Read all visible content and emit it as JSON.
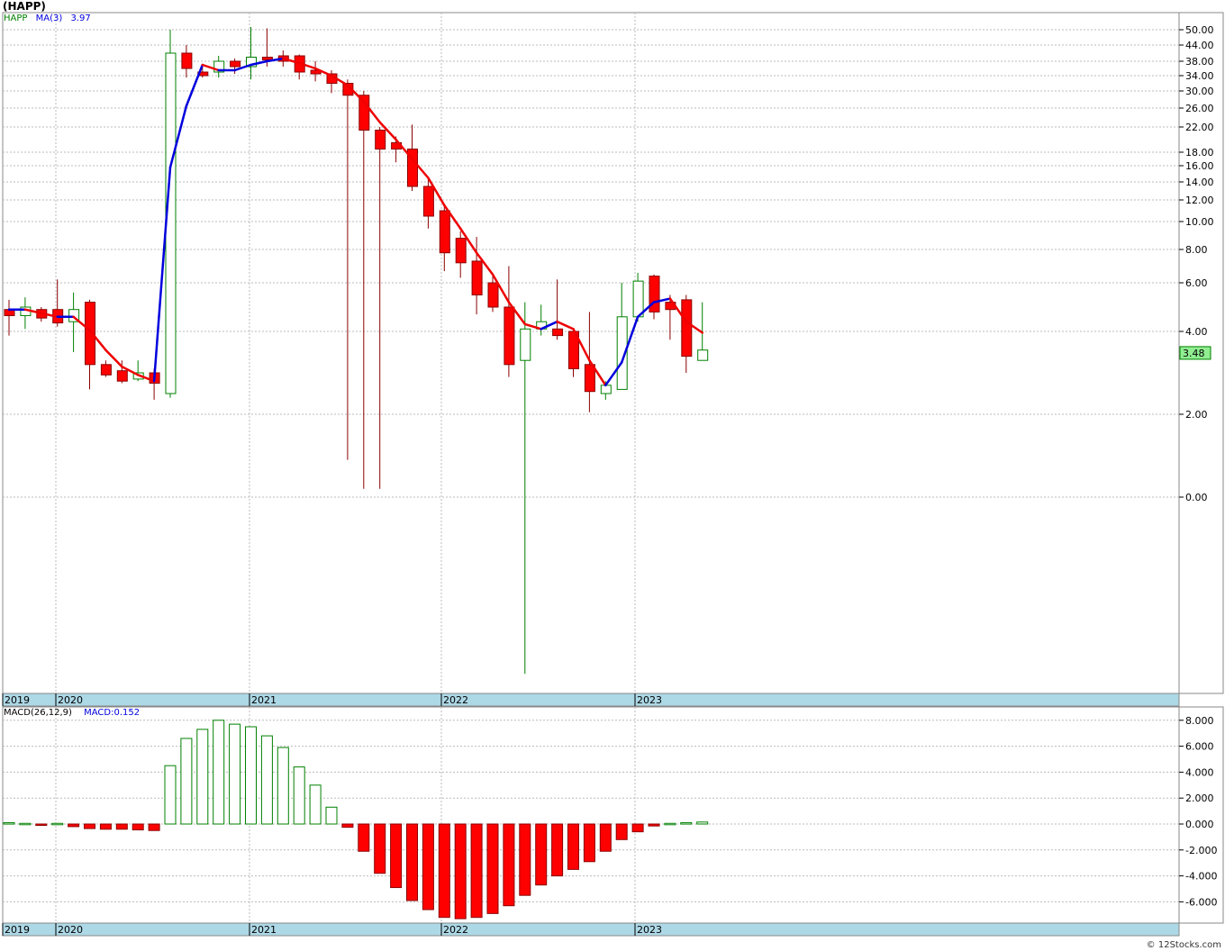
{
  "header": {
    "title": "(HAPP)",
    "symbol": "HAPP",
    "ma_label": "MA(3)",
    "ma_value": "3.97",
    "last_price": "3.48"
  },
  "macd_legend": {
    "label": "MACD(26,12,9)",
    "value": "MACD:0.152"
  },
  "credit": "© 12Stocks.com",
  "colors": {
    "up": "#008000",
    "down": "#ff0000",
    "ma_up": "#0000dd",
    "ma_down": "#ee0000",
    "axis_band": "#add8e6",
    "grid": "#bbbbbb"
  },
  "chart_data": [
    {
      "type": "candlestick",
      "title": "(HAPP)",
      "interval": "monthly",
      "price_axis_ticks": [
        "50.00",
        "44.00",
        "38.00",
        "34.00",
        "30.00",
        "26.00",
        "22.00",
        "18.00",
        "16.00",
        "14.00",
        "12.00",
        "10.00",
        "8.00",
        "6.00",
        "4.00",
        "2.00",
        "0.00"
      ],
      "time_axis_labels": [
        "2019",
        "2020",
        "2021",
        "2022",
        "2023"
      ],
      "ma_period": 3,
      "candles": [
        {
          "o": 4.9,
          "h": 5.3,
          "l": 3.9,
          "c": 4.65
        },
        {
          "o": 4.65,
          "h": 5.4,
          "l": 4.1,
          "c": 5.0
        },
        {
          "o": 4.9,
          "h": 5.0,
          "l": 4.4,
          "c": 4.55
        },
        {
          "o": 4.9,
          "h": 6.2,
          "l": 4.2,
          "c": 4.35
        },
        {
          "o": 4.4,
          "h": 5.6,
          "l": 3.5,
          "c": 4.9
        },
        {
          "o": 5.2,
          "h": 5.3,
          "l": 2.6,
          "c": 3.2
        },
        {
          "o": 3.2,
          "h": 3.3,
          "l": 2.9,
          "c": 2.95
        },
        {
          "o": 3.05,
          "h": 3.3,
          "l": 2.75,
          "c": 2.8
        },
        {
          "o": 2.85,
          "h": 3.3,
          "l": 2.8,
          "c": 3.0
        },
        {
          "o": 3.0,
          "h": 3.1,
          "l": 2.35,
          "c": 2.75
        },
        {
          "o": 2.5,
          "h": 50.0,
          "l": 2.4,
          "c": 41.0
        },
        {
          "o": 41.0,
          "h": 44.0,
          "l": 33.5,
          "c": 36.0
        },
        {
          "o": 35.0,
          "h": 36.5,
          "l": 33.5,
          "c": 34.0
        },
        {
          "o": 35.0,
          "h": 40.0,
          "l": 33.5,
          "c": 38.0
        },
        {
          "o": 38.0,
          "h": 39.0,
          "l": 34.5,
          "c": 36.5
        },
        {
          "o": 36.5,
          "h": 51.0,
          "l": 33.0,
          "c": 39.5
        },
        {
          "o": 39.5,
          "h": 50.5,
          "l": 36.5,
          "c": 38.5
        },
        {
          "o": 40.0,
          "h": 42.0,
          "l": 36.5,
          "c": 38.0
        },
        {
          "o": 40.0,
          "h": 40.5,
          "l": 33.0,
          "c": 35.0
        },
        {
          "o": 35.5,
          "h": 38.0,
          "l": 32.5,
          "c": 34.5
        },
        {
          "o": 34.5,
          "h": 35.5,
          "l": 29.5,
          "c": 32.0
        },
        {
          "o": 32.0,
          "h": 33.0,
          "l": 0.9,
          "c": 29.0
        },
        {
          "o": 29.0,
          "h": 30.0,
          "l": 0.2,
          "c": 21.5
        },
        {
          "o": 21.5,
          "h": 22.0,
          "l": 0.2,
          "c": 18.5
        },
        {
          "o": 19.5,
          "h": 20.5,
          "l": 16.5,
          "c": 18.5
        },
        {
          "o": 18.5,
          "h": 22.5,
          "l": 13.0,
          "c": 13.5
        },
        {
          "o": 13.5,
          "h": 14.5,
          "l": 9.5,
          "c": 10.5
        },
        {
          "o": 11.0,
          "h": 11.5,
          "l": 6.7,
          "c": 7.8
        },
        {
          "o": 8.8,
          "h": 9.3,
          "l": 6.3,
          "c": 7.2
        },
        {
          "o": 7.3,
          "h": 8.9,
          "l": 4.7,
          "c": 5.5
        },
        {
          "o": 6.0,
          "h": 6.6,
          "l": 4.8,
          "c": 5.0
        },
        {
          "o": 5.0,
          "h": 7.0,
          "l": 2.9,
          "c": 3.2
        },
        {
          "o": 3.3,
          "h": 5.2,
          "l": -0.9,
          "c": 4.1
        },
        {
          "o": 4.1,
          "h": 5.1,
          "l": 3.9,
          "c": 4.4
        },
        {
          "o": 4.1,
          "h": 6.2,
          "l": 3.8,
          "c": 3.9
        },
        {
          "o": 4.0,
          "h": 4.1,
          "l": 2.9,
          "c": 3.1
        },
        {
          "o": 3.2,
          "h": 4.8,
          "l": 2.05,
          "c": 2.55
        },
        {
          "o": 2.5,
          "h": 2.8,
          "l": 2.35,
          "c": 2.7
        },
        {
          "o": 2.6,
          "h": 6.0,
          "l": 2.6,
          "c": 4.6
        },
        {
          "o": 4.6,
          "h": 6.6,
          "l": 4.4,
          "c": 6.1
        },
        {
          "o": 6.4,
          "h": 6.5,
          "l": 4.5,
          "c": 4.8
        },
        {
          "o": 5.2,
          "h": 5.5,
          "l": 3.8,
          "c": 4.9
        },
        {
          "o": 5.3,
          "h": 5.5,
          "l": 3.0,
          "c": 3.4
        },
        {
          "o": 3.3,
          "h": 5.2,
          "l": 3.3,
          "c": 3.55
        }
      ],
      "moving_average": [
        4.9,
        4.9,
        4.75,
        4.6,
        4.6,
        4.05,
        3.55,
        3.15,
        2.95,
        2.8,
        15.8,
        26.5,
        37.0,
        35.5,
        35.5,
        37.0,
        38.0,
        39.0,
        37.5,
        36.0,
        34.0,
        31.5,
        27.5,
        23.0,
        20.0,
        17.0,
        14.5,
        11.5,
        9.5,
        7.8,
        6.5,
        5.2,
        4.3,
        4.1,
        4.4,
        4.1,
        3.3,
        2.7,
        3.25,
        4.6,
        5.2,
        5.35,
        4.4,
        3.97
      ]
    },
    {
      "type": "bar",
      "title": "MACD(26,12,9)",
      "value_axis_ticks": [
        "8.000",
        "6.000",
        "4.000",
        "2.000",
        "0.000",
        "-2.000",
        "-4.000",
        "-6.000"
      ],
      "values": [
        0.1,
        0.05,
        -0.05,
        0.05,
        -0.2,
        -0.35,
        -0.4,
        -0.4,
        -0.45,
        -0.5,
        4.5,
        6.6,
        7.3,
        8.0,
        7.7,
        7.5,
        6.8,
        5.9,
        4.4,
        3.0,
        1.3,
        -0.25,
        -2.1,
        -3.8,
        -4.9,
        -5.9,
        -6.6,
        -7.2,
        -7.3,
        -7.2,
        -6.9,
        -6.3,
        -5.5,
        -4.7,
        -4.0,
        -3.5,
        -2.9,
        -2.1,
        -1.2,
        -0.6,
        -0.15,
        0.05,
        0.1,
        0.152
      ],
      "time_axis_labels": [
        "2019",
        "2020",
        "2021",
        "2022",
        "2023"
      ]
    }
  ]
}
